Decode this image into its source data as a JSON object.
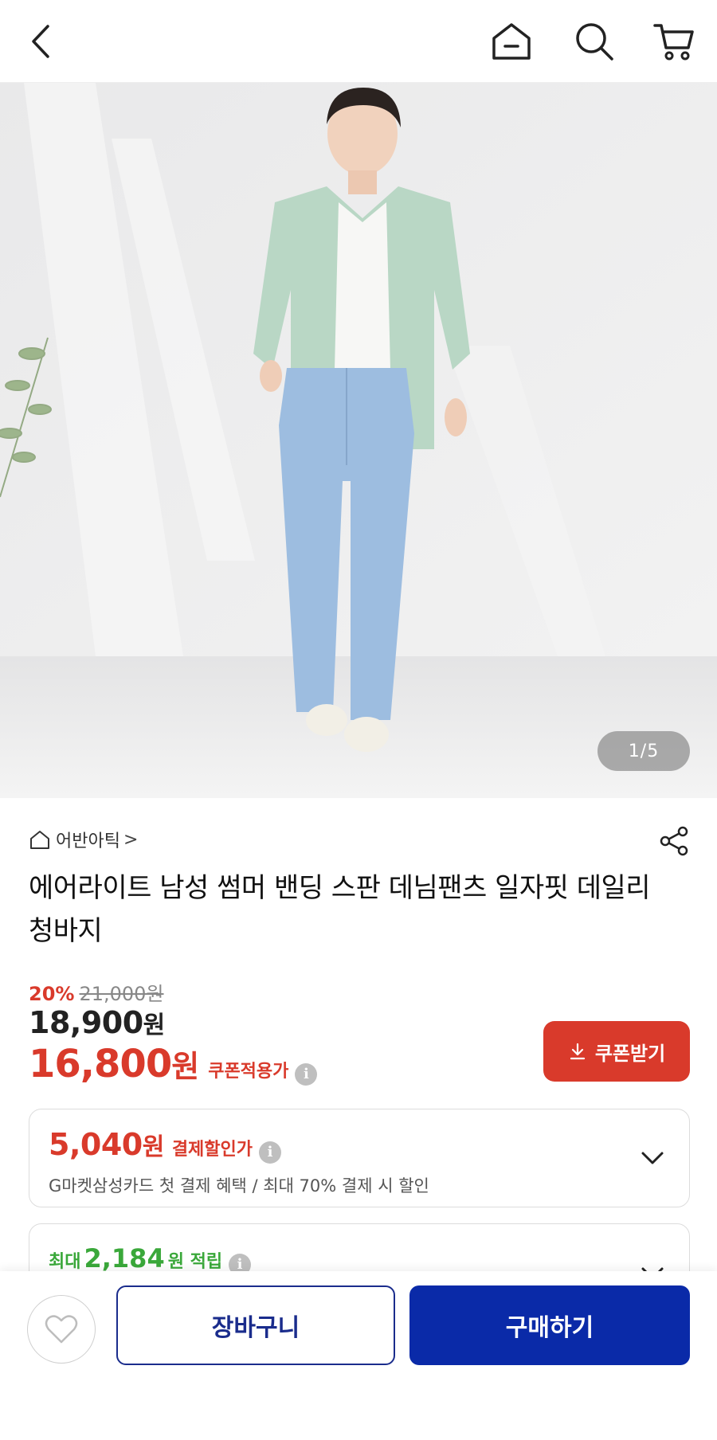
{
  "header": {
    "icons": {
      "back": "chevron-left-icon",
      "home": "home-icon",
      "search": "search-icon",
      "cart": "cart-icon"
    }
  },
  "hero": {
    "counter": "1/5"
  },
  "product": {
    "store_name": "어반아틱",
    "store_chevron": ">",
    "title": "에어라이트 남성 썸머 밴딩 스판 데님팬츠 일자핏 데일리청바지",
    "discount_rate": "20%",
    "original_price": "21,000원",
    "sale_price_number": "18,900",
    "sale_price_unit": "원",
    "coupon_price_number": "16,800",
    "coupon_price_unit": "원",
    "coupon_price_label": "쿠폰적용가",
    "coupon_button_label": "쿠폰받기"
  },
  "benefit": {
    "amount_number": "5,040",
    "amount_unit": "원",
    "label": "결제할인가",
    "description": "G마켓삼성카드 첫 결제 혜택 / 최대 70% 결제 시 할인"
  },
  "points": {
    "prefix": "최대",
    "amount": "2,184",
    "unit": "원 적립"
  },
  "actions": {
    "cart_label": "장바구니",
    "buy_label": "구매하기"
  },
  "colors": {
    "accent_red": "#d93a2b",
    "primary_blue": "#0a2aa8",
    "points_green": "#3aa83a"
  }
}
